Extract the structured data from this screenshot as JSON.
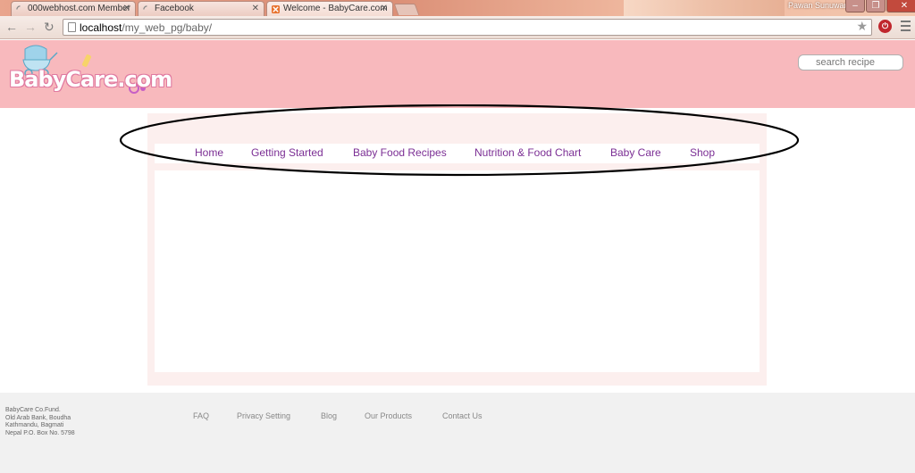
{
  "browser": {
    "tabs": [
      {
        "title": "000webhost.com Member",
        "active": false
      },
      {
        "title": "Facebook",
        "active": false
      },
      {
        "title": "Welcome - BabyCare.com",
        "active": true
      }
    ],
    "user_name": "Pawan Sunuwar",
    "url_host": "localhost",
    "url_path": "/my_web_pg/baby/"
  },
  "site": {
    "logo_text": "BabyCare.com",
    "search_placeholder": "search recipe",
    "nav": [
      "Home",
      "Getting Started",
      "Baby Food Recipes",
      "Nutrition & Food Chart",
      "Baby Care",
      "Shop"
    ],
    "colors": {
      "header": "#f8b9bd",
      "nav_text": "#7b2e94",
      "container": "#fcefee",
      "footer": "#f1f1f1"
    }
  },
  "footer": {
    "address": [
      "BabyCare Co.Fund.",
      "Old Arab Bank, Boudha",
      "Kathmandu, Bagmati",
      "Nepal P.O. Box No. 5798"
    ],
    "links": [
      "FAQ",
      "Privacy Setting",
      "Blog",
      "Our Products",
      "Contact Us"
    ]
  }
}
